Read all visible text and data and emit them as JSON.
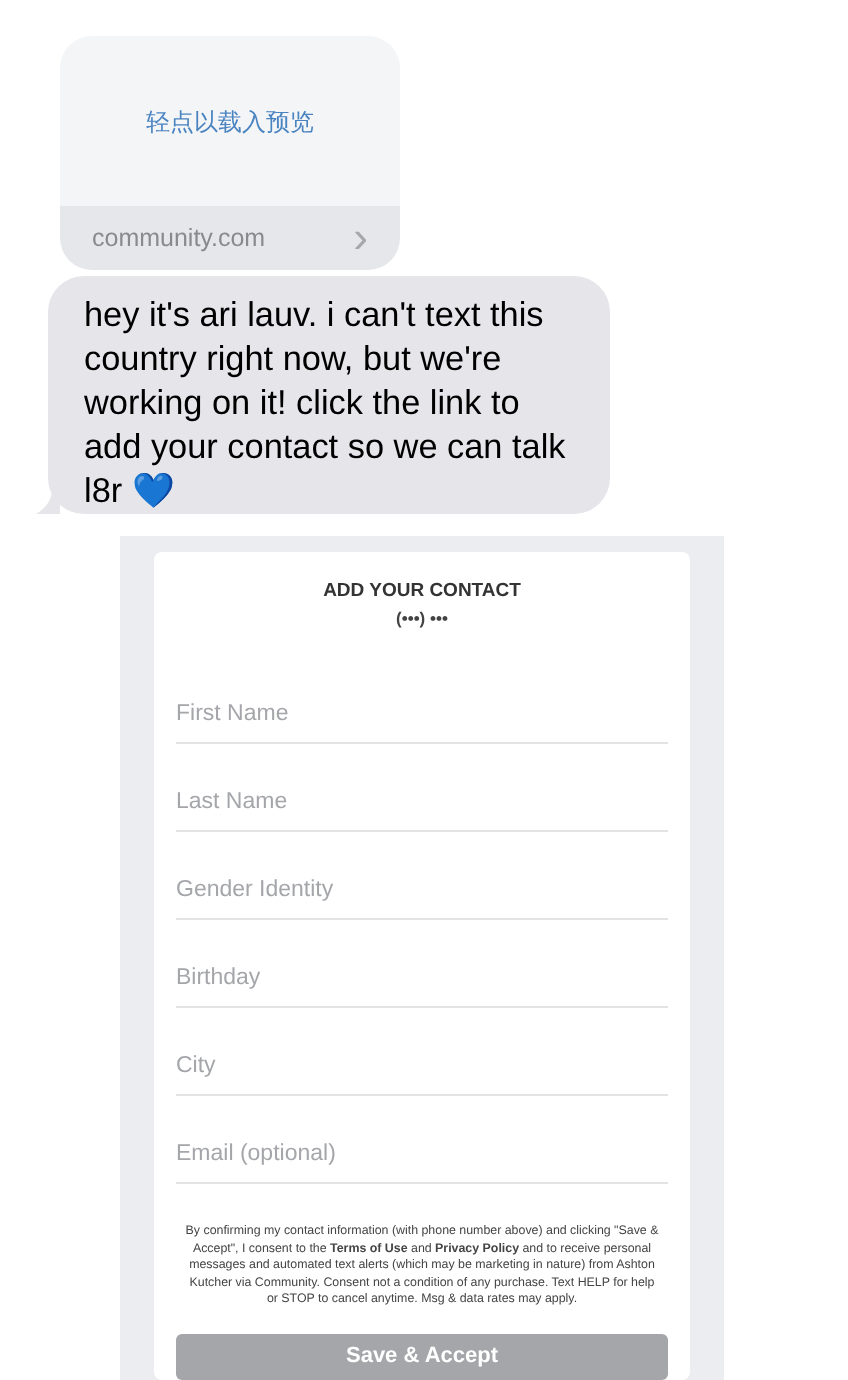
{
  "link_preview": {
    "prompt": "轻点以载入预览",
    "domain": "community.com",
    "chevron": "›"
  },
  "message": {
    "text": "hey it's ari lauv. i can't text this country right now, but we're working on it! click the link to add your contact so we can talk l8r 💙"
  },
  "form": {
    "title": "ADD YOUR CONTACT",
    "phone": "(•••) •••",
    "fields": [
      {
        "placeholder": "First Name"
      },
      {
        "placeholder": "Last Name"
      },
      {
        "placeholder": "Gender Identity"
      },
      {
        "placeholder": "Birthday"
      },
      {
        "placeholder": "City"
      },
      {
        "placeholder": "Email (optional)"
      }
    ],
    "consent": "By confirming my contact information (with phone number above) and clicking \"Save & Accept\", I consent to the **Terms of Use** and **Privacy Policy** and to receive personal messages and automated text alerts (which may be marketing in nature) from Ashton Kutcher via Community. Consent not a condition of any purchase. Text HELP for help or STOP to cancel anytime. Msg & data rates may apply.",
    "button": {
      "label": "Save & Accept",
      "disabled": true
    }
  }
}
